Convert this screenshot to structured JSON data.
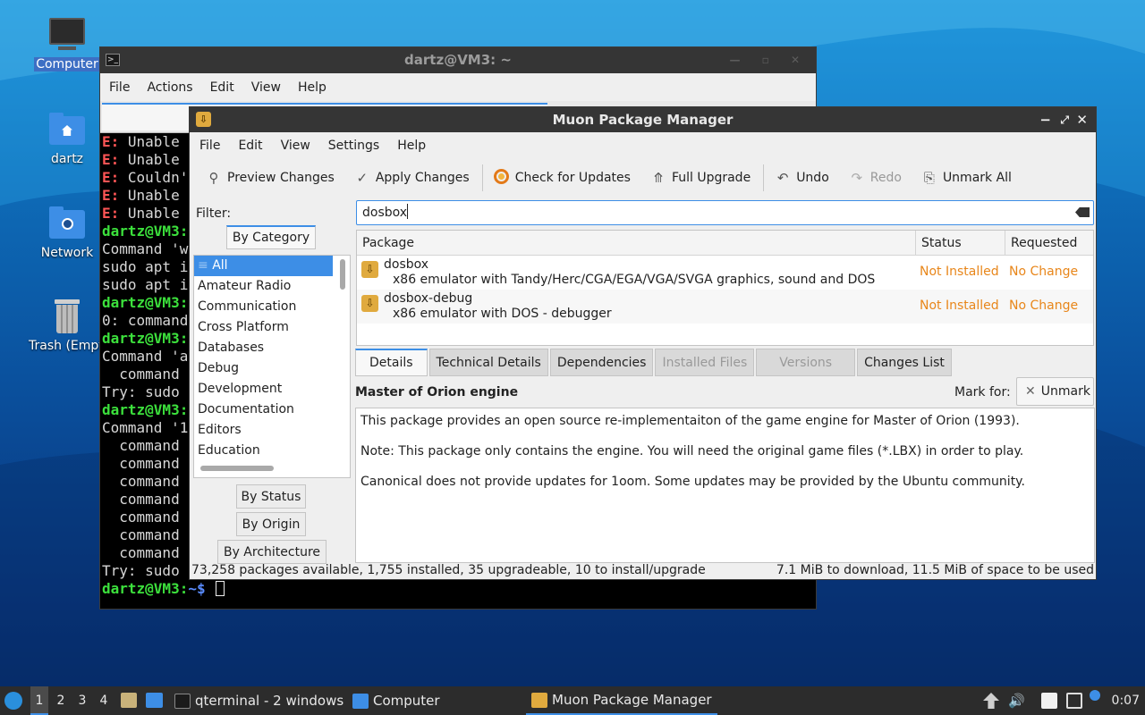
{
  "desktop": {
    "icons": [
      {
        "label": "Computer"
      },
      {
        "label": "dartz"
      },
      {
        "label": "Network"
      },
      {
        "label": "Trash (Empty)"
      }
    ]
  },
  "terminal": {
    "title": "dartz@VM3: ~",
    "menu": [
      "File",
      "Actions",
      "Edit",
      "View",
      "Help"
    ],
    "lines": [
      {
        "e": "E:",
        "t": " Unable"
      },
      {
        "e": "E:",
        "t": " Unable"
      },
      {
        "e": "E:",
        "t": " Couldn'"
      },
      {
        "e": "E:",
        "t": " Unable"
      },
      {
        "e": "E:",
        "t": " Unable"
      },
      {
        "p": "dartz@VM3:",
        "t": ""
      },
      {
        "t": "Command 'w"
      },
      {
        "t": "sudo apt i"
      },
      {
        "t": "sudo apt i"
      },
      {
        "p": "dartz@VM3:",
        "t": ""
      },
      {
        "t": "0: command"
      },
      {
        "p": "dartz@VM3:",
        "t": ""
      },
      {
        "t": "Command 'a"
      },
      {
        "t": "  command"
      },
      {
        "t": "Try: sudo"
      },
      {
        "p": "dartz@VM3:",
        "t": ""
      },
      {
        "t": "Command '1"
      },
      {
        "t": "  command"
      },
      {
        "t": "  command"
      },
      {
        "t": "  command"
      },
      {
        "t": "  command"
      },
      {
        "t": "  command"
      },
      {
        "t": "  command"
      },
      {
        "t": "  command"
      },
      {
        "t": "Try: sudo"
      }
    ],
    "prompt_user": "dartz@VM3:",
    "prompt_path": "~$"
  },
  "muon": {
    "title": "Muon Package Manager",
    "menu": [
      "File",
      "Edit",
      "View",
      "Settings",
      "Help"
    ],
    "toolbar": {
      "preview": "Preview Changes",
      "apply": "Apply Changes",
      "check": "Check for Updates",
      "upgrade": "Full Upgrade",
      "undo": "Undo",
      "redo": "Redo",
      "unmark_all": "Unmark All"
    },
    "filter_label": "Filter:",
    "filter_tabs": {
      "category": "By Category",
      "status": "By Status",
      "origin": "By Origin",
      "arch": "By Architecture"
    },
    "categories": [
      "All",
      "Amateur Radio",
      "Communication",
      "Cross Platform",
      "Databases",
      "Debug",
      "Development",
      "Documentation",
      "Editors",
      "Education"
    ],
    "search_value": "dosbox",
    "columns": {
      "package": "Package",
      "status": "Status",
      "requested": "Requested"
    },
    "packages": [
      {
        "name": "dosbox",
        "desc": "x86 emulator with Tandy/Herc/CGA/EGA/VGA/SVGA graphics, sound and DOS",
        "status": "Not Installed",
        "requested": "No Change"
      },
      {
        "name": "dosbox-debug",
        "desc": "x86 emulator with DOS - debugger",
        "status": "Not Installed",
        "requested": "No Change"
      }
    ],
    "detail_tabs": {
      "details": "Details",
      "technical": "Technical Details",
      "dependencies": "Dependencies",
      "installed": "Installed Files",
      "versions": "Versions",
      "changes": "Changes List"
    },
    "detail_title": "Master of Orion engine",
    "mark_for": "Mark for:",
    "unmark": "Unmark",
    "description": [
      "This package provides an open source re-implementaiton of the game engine for Master of Orion (1993).",
      "Note: This package only contains the engine. You will need the original game files (*.LBX) in order to play.",
      "Canonical does not provide updates for 1oom. Some updates may be provided by the Ubuntu community."
    ],
    "status_left": "73,258 packages available, 1,755 installed, 35 upgradeable, 10 to install/upgrade",
    "status_right": "7.1 MiB to download, 11.5 MiB of space to be used"
  },
  "taskbar": {
    "workspaces": [
      "1",
      "2",
      "3",
      "4"
    ],
    "tasks": {
      "qterminal": "qterminal - 2 windows",
      "computer": "Computer",
      "muon": "Muon Package Manager"
    },
    "clock": "0:07"
  }
}
